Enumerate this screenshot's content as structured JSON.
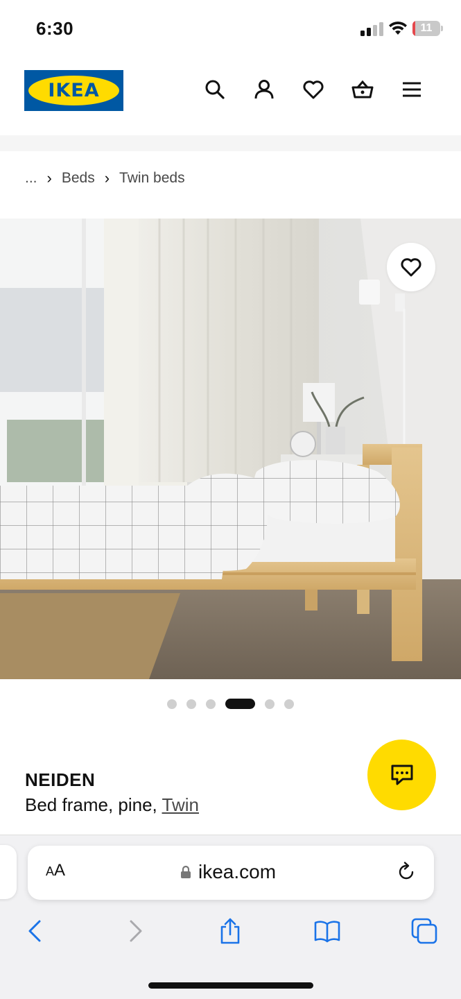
{
  "status_bar": {
    "time": "6:30",
    "battery_level": "11",
    "battery_fraction": 0.11,
    "icons": [
      "cellular-signal-icon",
      "wifi-icon",
      "battery-icon"
    ]
  },
  "header": {
    "logo_text": "IKEA",
    "brand_colors": {
      "blue": "#0058a3",
      "yellow": "#ffdb00"
    },
    "icons": [
      "search-icon",
      "account-icon",
      "heart-icon",
      "cart-icon",
      "menu-icon"
    ]
  },
  "breadcrumb": {
    "ellipsis": "...",
    "items": [
      {
        "label": "Beds"
      },
      {
        "label": "Twin beds"
      }
    ],
    "separator": "›"
  },
  "gallery": {
    "image_count": 6,
    "active_index": 3,
    "favorite_icon": "heart-icon"
  },
  "product": {
    "name": "NEIDEN",
    "description": "Bed frame, pine, ",
    "variant": "Twin"
  },
  "chat": {
    "icon": "chat-bubble-icon",
    "color": "#ffdb00"
  },
  "browser": {
    "aa_large": "A",
    "aa_small": "A",
    "url": "ikea.com",
    "icons": [
      "lock-icon",
      "reload-icon",
      "back-icon",
      "forward-icon",
      "share-icon",
      "bookmarks-icon",
      "tabs-icon"
    ],
    "accent": "#1a73e8"
  }
}
